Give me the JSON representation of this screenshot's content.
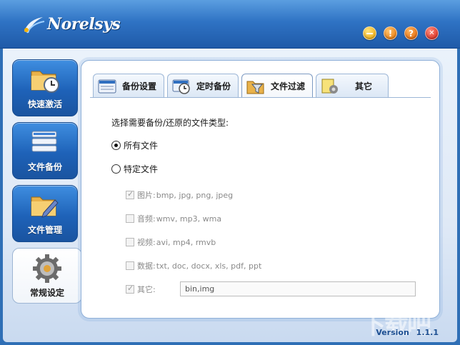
{
  "app": {
    "logo_text": "Norelsys",
    "version_label": "Version",
    "version_value": "1.1.1",
    "watermark": "下载吧"
  },
  "window_buttons": [
    {
      "name": "minimize",
      "icon": "minimize-icon"
    },
    {
      "name": "warning",
      "icon": "exclamation-icon",
      "glyph": "!"
    },
    {
      "name": "help",
      "icon": "question-icon",
      "glyph": "?"
    },
    {
      "name": "close",
      "icon": "close-icon",
      "glyph": "✕"
    }
  ],
  "nav": {
    "items": [
      {
        "label": "快速激活",
        "icon": "folder-clock-icon",
        "active": false
      },
      {
        "label": "文件备份",
        "icon": "stack-icon",
        "active": false
      },
      {
        "label": "文件管理",
        "icon": "folder-pen-icon",
        "active": false
      },
      {
        "label": "常规设定",
        "icon": "gear-icon",
        "active": true
      }
    ]
  },
  "tabs": [
    {
      "label": "备份设置",
      "icon": "window-icon",
      "active": false
    },
    {
      "label": "定时备份",
      "icon": "clock-icon",
      "active": false
    },
    {
      "label": "文件过滤",
      "icon": "filter-icon",
      "active": true
    },
    {
      "label": "其它",
      "icon": "gear-doc-icon",
      "active": false
    }
  ],
  "filter": {
    "section_label": "选择需要备份/还原的文件类型:",
    "radio_all": "所有文件",
    "radio_specific": "特定文件",
    "selected": "所有文件",
    "types": [
      {
        "prefix": "图片:",
        "exts": "bmp, jpg, png, jpeg",
        "checked": true
      },
      {
        "prefix": "音频:",
        "exts": "wmv, mp3, wma",
        "checked": false
      },
      {
        "prefix": "视频:",
        "exts": "avi, mp4, rmvb",
        "checked": false
      },
      {
        "prefix": "数据:",
        "exts": "txt, doc, docx, xls, pdf, ppt",
        "checked": false
      },
      {
        "prefix": "其它:",
        "exts": "",
        "checked": true
      }
    ],
    "other_value": "bin,img"
  },
  "colors": {
    "titlebar": "#2f73c4",
    "nav_blue": "#1e62b8",
    "panel_border": "#8fb0d8",
    "version_text": "#1d4f92"
  }
}
